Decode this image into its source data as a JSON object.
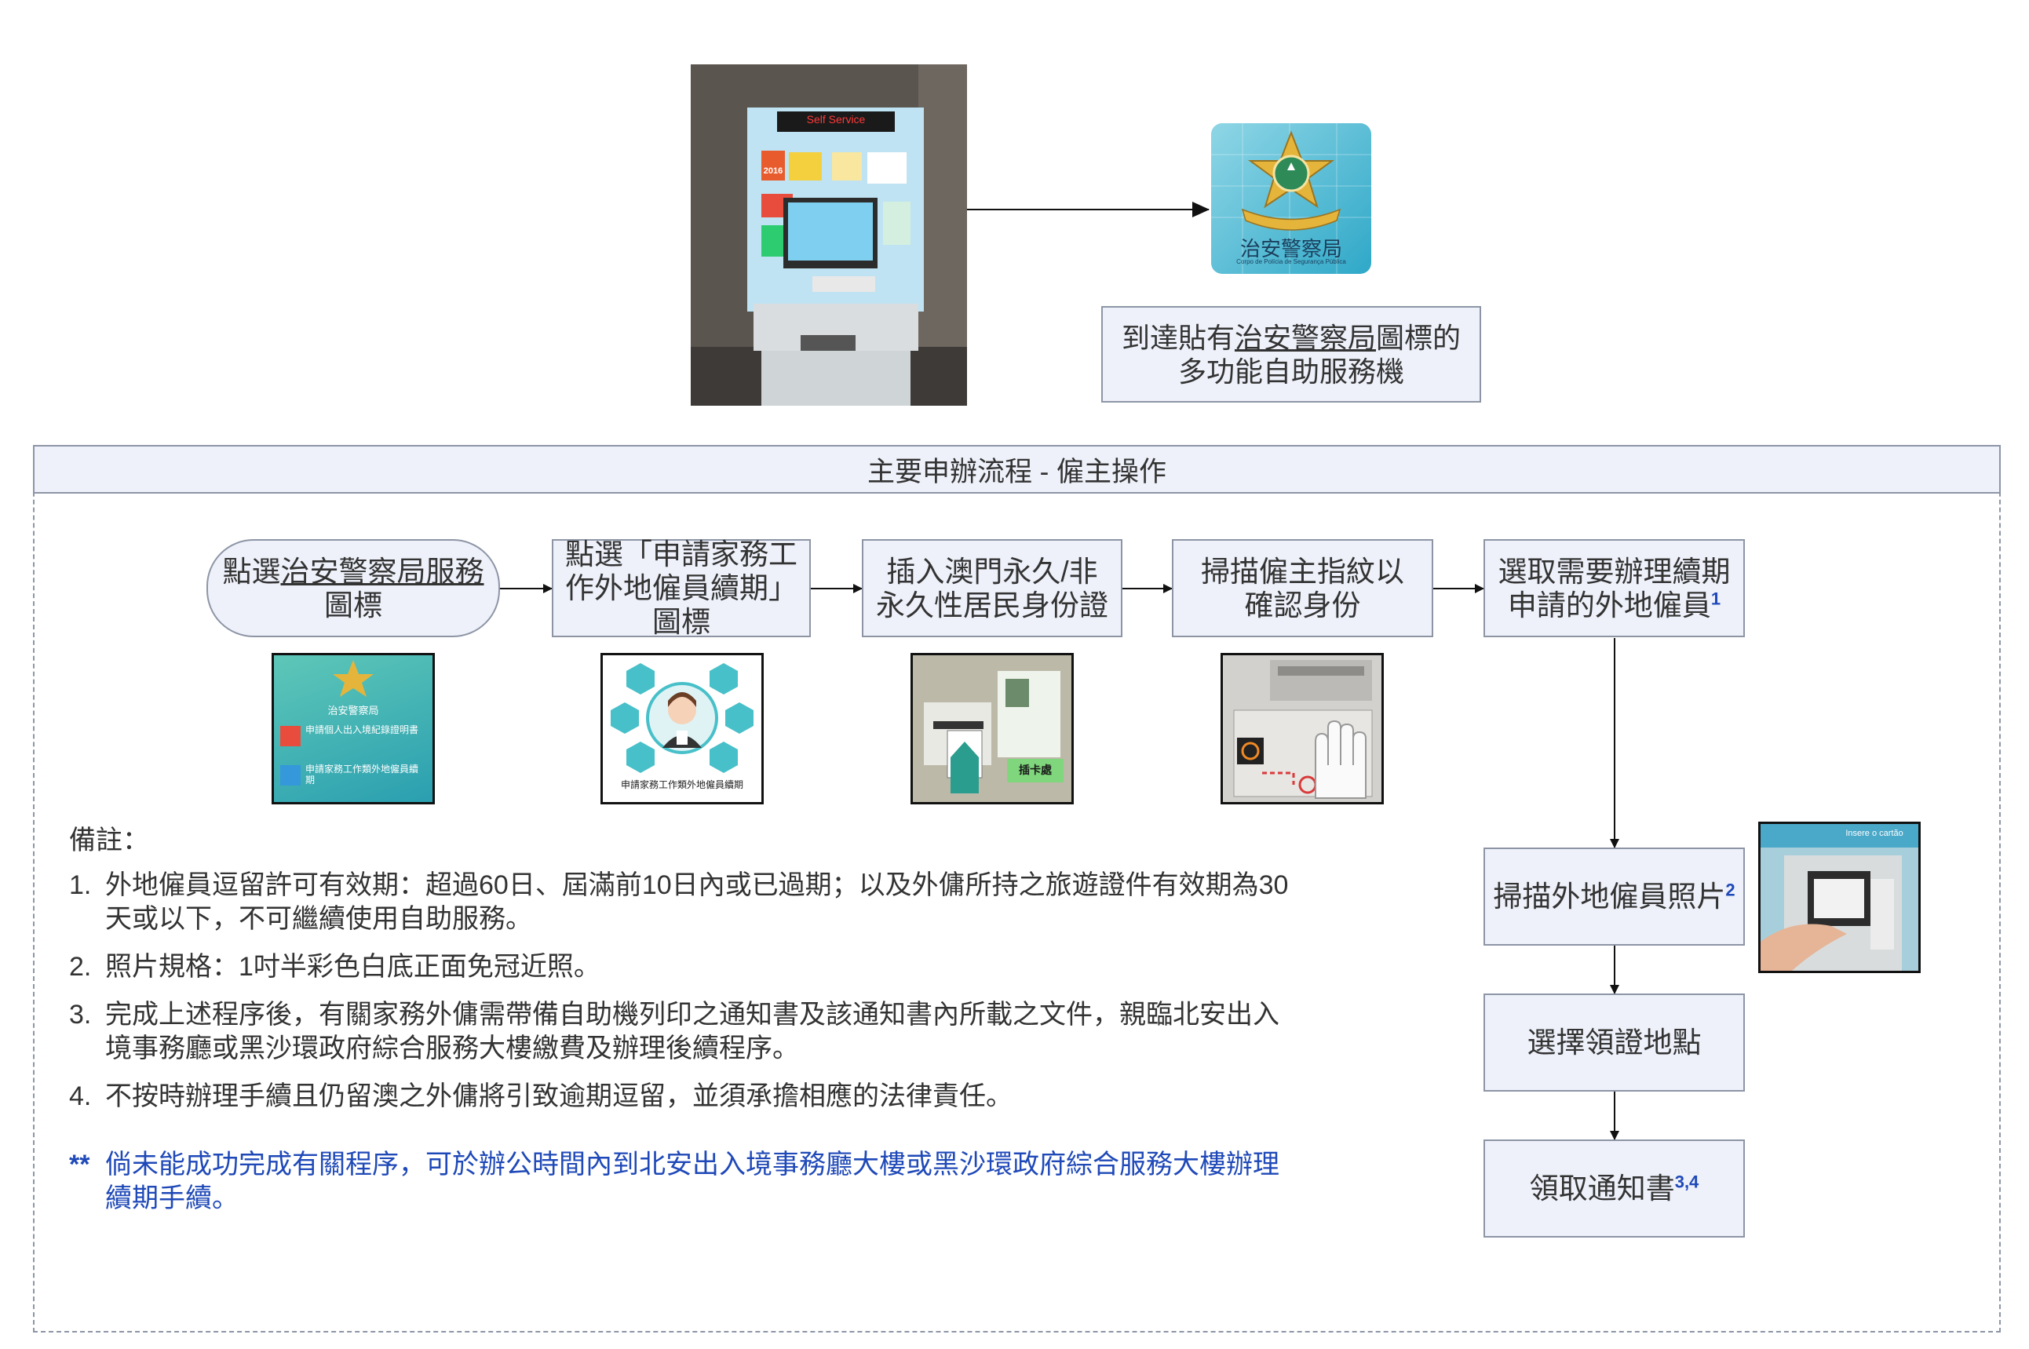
{
  "top": {
    "arrive_prefix": "到達貼有",
    "arrive_link": "治安警察局",
    "arrive_suffix": "圖標的",
    "arrive_line2": "多功能自助服務機",
    "kiosk_sign": "Self Service",
    "kiosk_year": "2016",
    "logo_text": "治安警察局",
    "logo_subtext": "Corpo de Polícia de Segurança Pública"
  },
  "panel": {
    "title": "主要申辦流程 - 僱主操作"
  },
  "steps": [
    {
      "pre": "點選",
      "link": "治安警察局服務",
      "post": "圖標"
    },
    {
      "text": "點選「申請家務工作外地僱員續期」圖標"
    },
    {
      "text": "插入澳門永久/非永久性居民身份證"
    },
    {
      "text": "掃描僱主指紋以確認身份"
    },
    {
      "text": "選取需要辦理續期申請的外地僱員",
      "sup": "1"
    },
    {
      "text": "掃描外地僱員照片",
      "sup": "2"
    },
    {
      "text": "選擇領證地點"
    },
    {
      "text": "領取通知書",
      "sup": "3,4"
    }
  ],
  "thumbs": {
    "psp_menu_title": "治安警察局",
    "psp_menu_item1": "申請個人出入境紀錄證明書",
    "psp_menu_item2": "申請家務工作類外地僱員續期",
    "domestic_caption": "申請家務工作類外地僱員續期",
    "id_card_label": "插卡處",
    "photo_scanner_label": "Insere o cartão"
  },
  "notes": {
    "heading": "備註：",
    "items": [
      {
        "num": "1.",
        "text": "外地僱員逗留許可有效期：超過60日、屆滿前10日內或已過期；以及外傭所持之旅遊證件有效期為30天或以下，不可繼續使用自助服務。"
      },
      {
        "num": "2.",
        "text": "照片規格：1吋半彩色白底正面免冠近照。"
      },
      {
        "num": "3.",
        "text": "完成上述程序後，有關家務外傭需帶備自助機列印之通知書及該通知書內所載之文件，親臨北安出入境事務廳或黑沙環政府綜合服務大樓繳費及辦理後續程序。"
      },
      {
        "num": "4.",
        "text": "不按時辦理手續且仍留澳之外傭將引致逾期逗留，並須承擔相應的法律責任。"
      }
    ],
    "warn_mark": "**",
    "warn_text": "倘未能成功完成有關程序，可於辦公時間內到北安出入境事務廳大樓或黑沙環政府綜合服務大樓辦理續期手續。"
  },
  "colors": {
    "box_fill": "#eef1fa",
    "box_border": "#8d95a5",
    "accent_blue": "#1f49b8"
  }
}
